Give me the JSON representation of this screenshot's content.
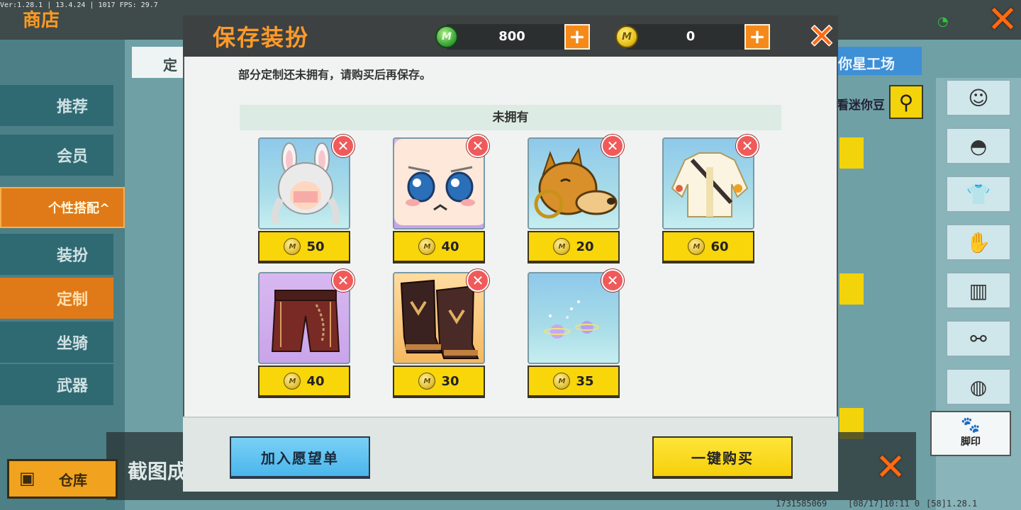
{
  "background": {
    "version_text": "Ver:1.28.1 | 13.4.24 | 1017 FPS: 29.7",
    "shop_title": "商店",
    "sidebar": [
      {
        "label": "推荐",
        "style": "teal"
      },
      {
        "label": "会员",
        "style": "teal"
      },
      {
        "label": "个性搭配^",
        "style": "gold"
      },
      {
        "label": "装扮",
        "style": "teal"
      },
      {
        "label": "定制",
        "style": "orange"
      },
      {
        "label": "坐骑",
        "style": "teal"
      },
      {
        "label": "武器",
        "style": "teal"
      }
    ],
    "warehouse_label": "仓库",
    "tab_custom": "定",
    "tab_mini_workshop": "你星工场",
    "search_hint": "看迷你豆",
    "screenshot_hint": "截图成",
    "footprint_label": "脚印",
    "player_id": "1731585069",
    "timestamp": "[08/17]10:11 0",
    "build": "[58]1.28.1"
  },
  "modal": {
    "title": "保存装扮",
    "currency": {
      "gem_icon": "green-gem-icon",
      "gem_amount": "800",
      "coin_icon": "mini-coin-icon",
      "coin_amount": "0"
    },
    "notice": "部分定制还未拥有，请购买后再保存。",
    "section_title": "未拥有",
    "items": [
      {
        "name": "bunny-ear-hair",
        "price": "50",
        "bg": "blue"
      },
      {
        "name": "worried-face",
        "price": "40",
        "bg": "purple"
      },
      {
        "name": "shiba-mask",
        "price": "20",
        "bg": "blue"
      },
      {
        "name": "white-jacket",
        "price": "60",
        "bg": "blue"
      },
      {
        "name": "chain-shorts",
        "price": "40",
        "bg": "purple"
      },
      {
        "name": "dark-boots",
        "price": "30",
        "bg": "orange"
      },
      {
        "name": "planet-footprint-effect",
        "price": "35",
        "bg": "blue"
      }
    ],
    "wishlist_button": "加入愿望单",
    "buy_all_button": "一键购买"
  }
}
